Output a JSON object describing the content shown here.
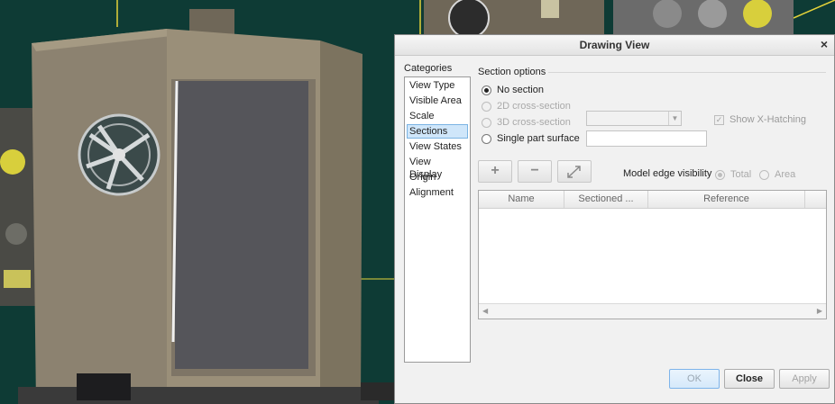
{
  "dialog": {
    "title": "Drawing View",
    "close_glyph": "×",
    "categories_label": "Categories",
    "categories": [
      "View Type",
      "Visible Area",
      "Scale",
      "Sections",
      "View States",
      "View Display",
      "Origin",
      "Alignment"
    ],
    "selected_category": "Sections",
    "section_options_label": "Section options",
    "options": {
      "no_section": "No section",
      "cross_2d": "2D cross-section",
      "cross_3d": "3D cross-section",
      "single_part": "Single part surface"
    },
    "selected_option": "No section",
    "show_hatching": "Show X-Hatching",
    "single_part_value": "",
    "toolbar": {
      "add_glyph": "+",
      "remove_glyph": "−"
    },
    "edge_visibility": {
      "label": "Model edge visibility",
      "total": "Total",
      "area": "Area",
      "selected": "Total"
    },
    "table": {
      "columns": [
        "Name",
        "Sectioned ...",
        "Reference"
      ],
      "rows": []
    },
    "buttons": {
      "ok": "OK",
      "close": "Close",
      "apply": "Apply"
    }
  },
  "viewport": {
    "background": "#0e3b35",
    "panel_color": "#8c8270"
  }
}
